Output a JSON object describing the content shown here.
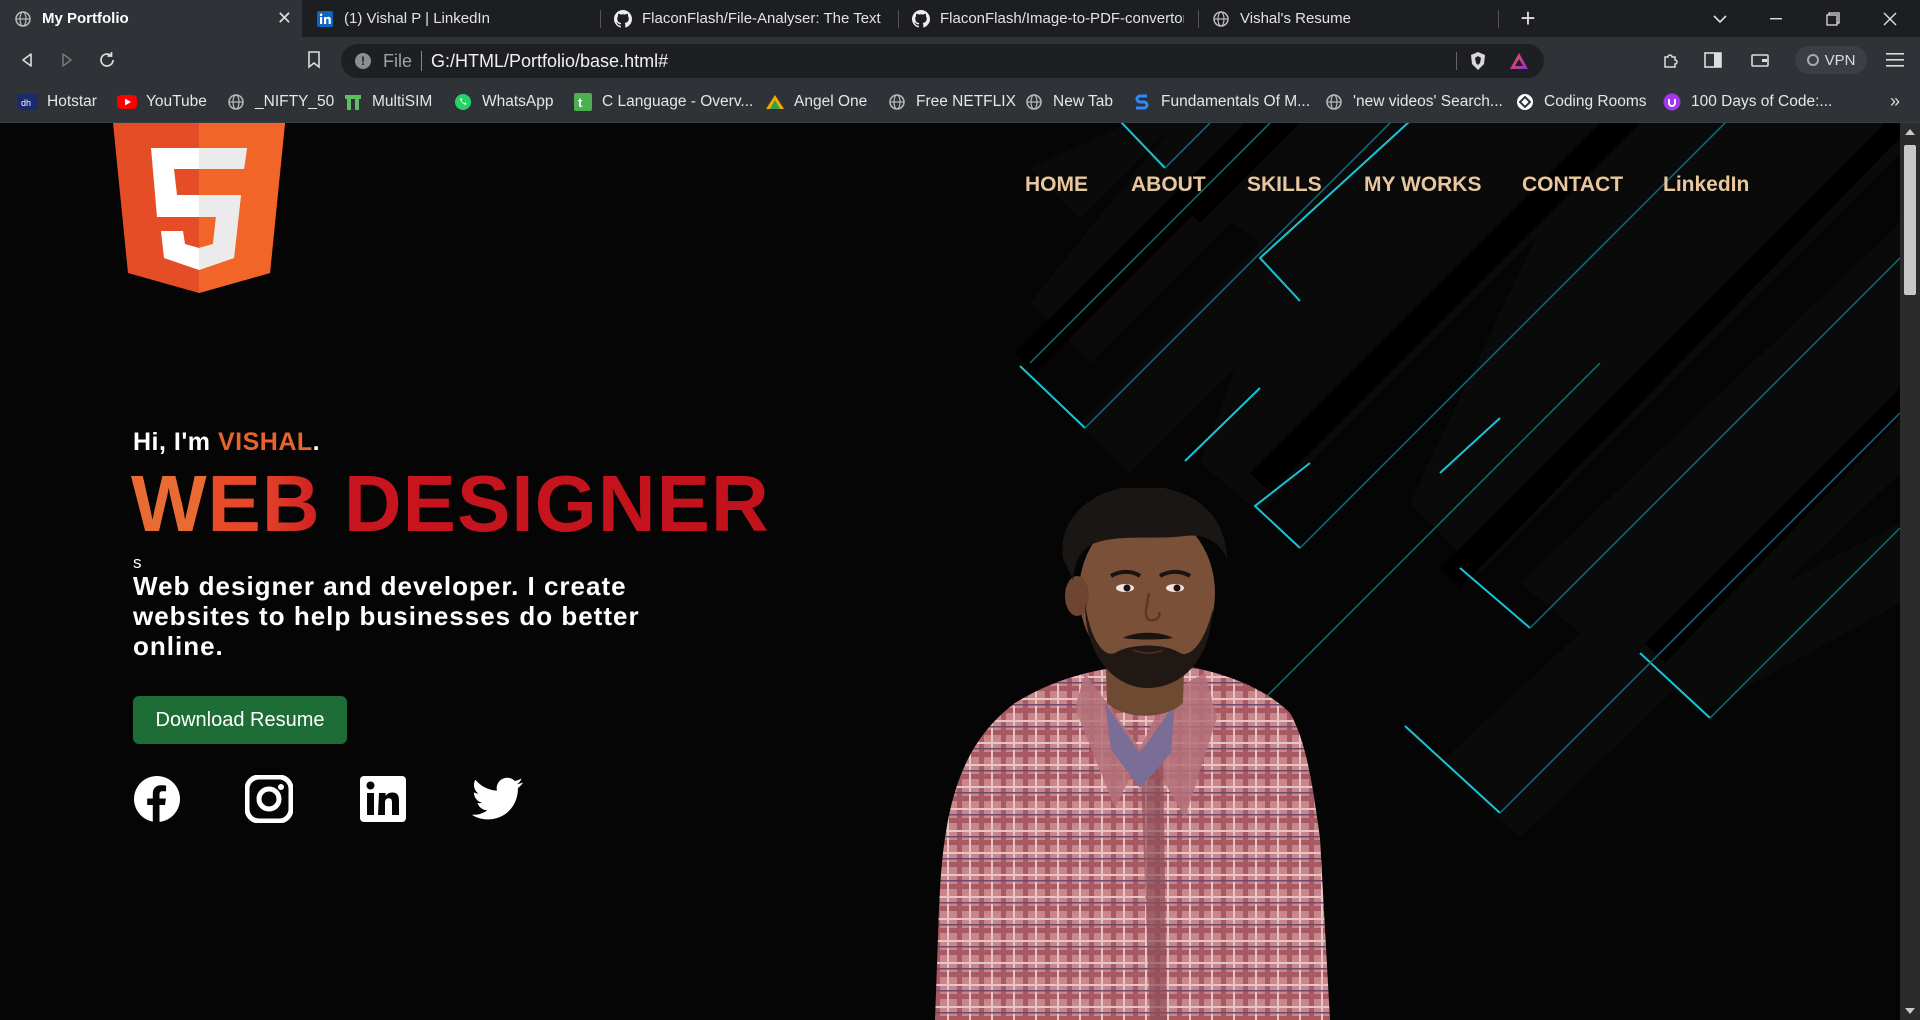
{
  "browser": {
    "tabs": [
      {
        "label": "My Portfolio",
        "icon": "globe-icon",
        "active": true
      },
      {
        "label": "(1) Vishal P | LinkedIn",
        "icon": "linkedin-icon",
        "active": false
      },
      {
        "label": "FlaconFlash/File-Analyser: The Text File",
        "icon": "github-icon",
        "active": false
      },
      {
        "label": "FlaconFlash/Image-to-PDF-convertor-",
        "icon": "github-icon",
        "active": false
      },
      {
        "label": "Vishal's Resume",
        "icon": "globe-icon",
        "active": false
      }
    ],
    "address": {
      "scheme": "File",
      "url": "G:/HTML/Portfolio/base.html#"
    },
    "vpn_label": "VPN",
    "bookmarks": [
      {
        "label": "Hotstar",
        "icon": "hotstar-icon"
      },
      {
        "label": "YouTube",
        "icon": "youtube-icon"
      },
      {
        "label": "_NIFTY_50",
        "icon": "globe-icon"
      },
      {
        "label": "MultiSIM",
        "icon": "multisim-icon"
      },
      {
        "label": "WhatsApp",
        "icon": "whatsapp-icon"
      },
      {
        "label": "C Language - Overv...",
        "icon": "tutorial-icon"
      },
      {
        "label": "Angel One",
        "icon": "angel-one-icon"
      },
      {
        "label": "Free NETFLIX",
        "icon": "globe-icon"
      },
      {
        "label": "New Tab",
        "icon": "globe-icon"
      },
      {
        "label": "Fundamentals Of M...",
        "icon": "s-logo-icon"
      },
      {
        "label": "'new videos' Search...",
        "icon": "globe-icon"
      },
      {
        "label": "Coding Rooms",
        "icon": "coding-rooms-icon"
      },
      {
        "label": "100 Days of Code:...",
        "icon": "udemy-icon"
      }
    ],
    "more_glyph": "»",
    "new_tab_glyph": "+",
    "close_glyph": "✕"
  },
  "site": {
    "nav": [
      "HOME",
      "ABOUT",
      "SKILLS",
      "MY WORKS",
      "CONTACT",
      "LinkedIn"
    ],
    "greeting": "Hi, I'm ",
    "name": "VISHAL",
    "name_suffix": ".",
    "headline_first": "W",
    "headline_rest": "EB DESIGNER",
    "typed_char": "s",
    "description": "Web designer and developer. I create websites to help businesses do better online.",
    "download_button": "Download Resume",
    "social": [
      "facebook-icon",
      "instagram-icon",
      "linkedin-icon",
      "twitter-icon"
    ],
    "logo_digit": "5",
    "colors": {
      "nav": "#e8c79f",
      "accent": "#e8642b",
      "headline": "#c2121c",
      "button": "#1f6d36",
      "neon": "#19c6d8",
      "html5_orange": "#e44d26"
    }
  }
}
